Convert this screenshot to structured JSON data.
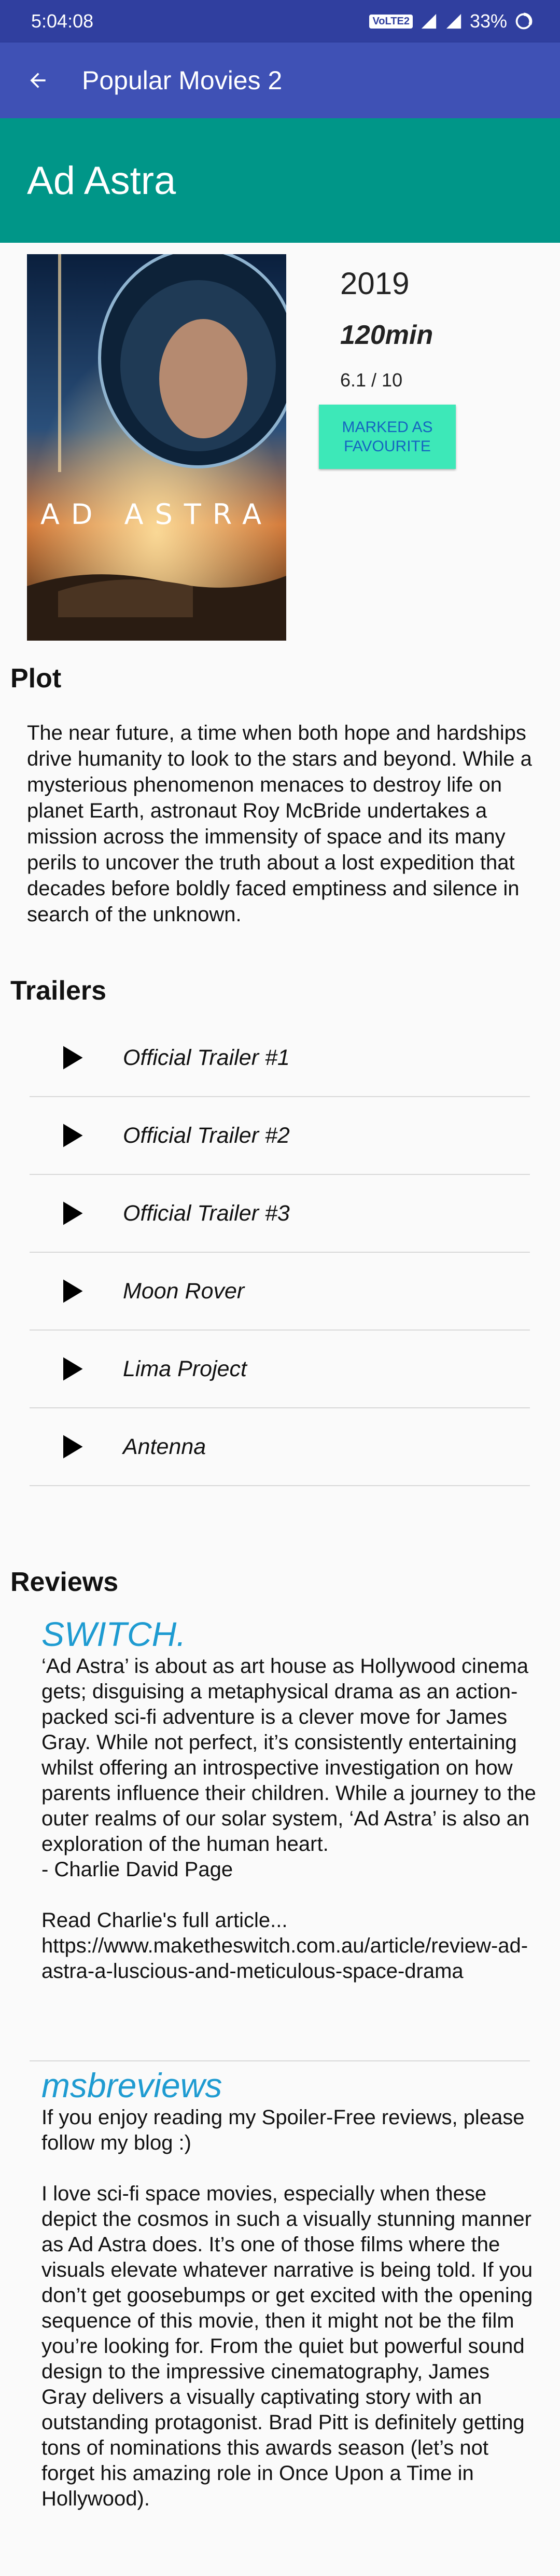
{
  "status_bar": {
    "time": "5:04:08",
    "network": "VoLTE2",
    "battery": "33%"
  },
  "app_bar": {
    "title": "Popular Movies 2"
  },
  "movie": {
    "title": "Ad Astra",
    "poster_text": "AD ASTRA",
    "year": "2019",
    "runtime": "120min",
    "rating": "6.1 / 10",
    "favourite_label": "MARKED AS FAVOURITE"
  },
  "plot": {
    "heading": "Plot",
    "text": "The near future, a time when both hope and hardships drive humanity to look to the stars and beyond. While a mysterious phenomenon menaces to destroy life on planet Earth, astronaut Roy McBride undertakes a mission across the immensity of space and its many perils to uncover the truth about a lost expedition that decades before boldly faced emptiness and silence in search of the unknown."
  },
  "trailers": {
    "heading": "Trailers",
    "items": [
      {
        "label": "Official Trailer #1"
      },
      {
        "label": "Official Trailer #2"
      },
      {
        "label": "Official Trailer #3"
      },
      {
        "label": "Moon Rover"
      },
      {
        "label": "Lima Project"
      },
      {
        "label": "Antenna"
      }
    ]
  },
  "reviews": {
    "heading": "Reviews",
    "items": [
      {
        "author": "SWITCH.",
        "content": "‘Ad Astra’ is about as art house as Hollywood cinema gets; disguising a metaphysical drama as an action-packed sci-fi adventure is a clever move for James Gray. While not perfect, it’s consistently entertaining whilst offering an introspective investigation on how parents influence their children. While a journey to the outer realms of our solar system, ‘Ad Astra’ is also an exploration of the human heart.\n- Charlie David Page\n\nRead Charlie's full article...\nhttps://www.maketheswitch.com.au/article/review-ad-astra-a-luscious-and-meticulous-space-drama"
      },
      {
        "author": "msbreviews",
        "content": "If you enjoy reading my Spoiler-Free reviews, please follow my blog :)\n\nI love sci-fi space movies, especially when these depict the cosmos in such a visually stunning manner as Ad Astra does. It’s one of those films where the visuals elevate whatever narrative is being told. If you don’t get goosebumps or get excited with the opening sequence of this movie, then it might not be the film you’re looking for. From the quiet but powerful sound design to the impressive cinematography, James Gray delivers a visually captivating story with an outstanding protagonist. Brad Pitt is definitely getting tons of nominations this awards season (let’s not forget his amazing role in Once Upon a Time in Hollywood)."
      }
    ]
  },
  "icons": {
    "back": "arrow-back-icon",
    "play": "play-icon",
    "signal": "signal-icon",
    "battery": "battery-icon"
  },
  "colors": {
    "status_bar": "#303f9f",
    "app_bar": "#3f51b5",
    "header": "#009688",
    "favourite_button": "#3de8b8",
    "favourite_text": "#1565c0",
    "review_author": "#1e9bd1"
  }
}
